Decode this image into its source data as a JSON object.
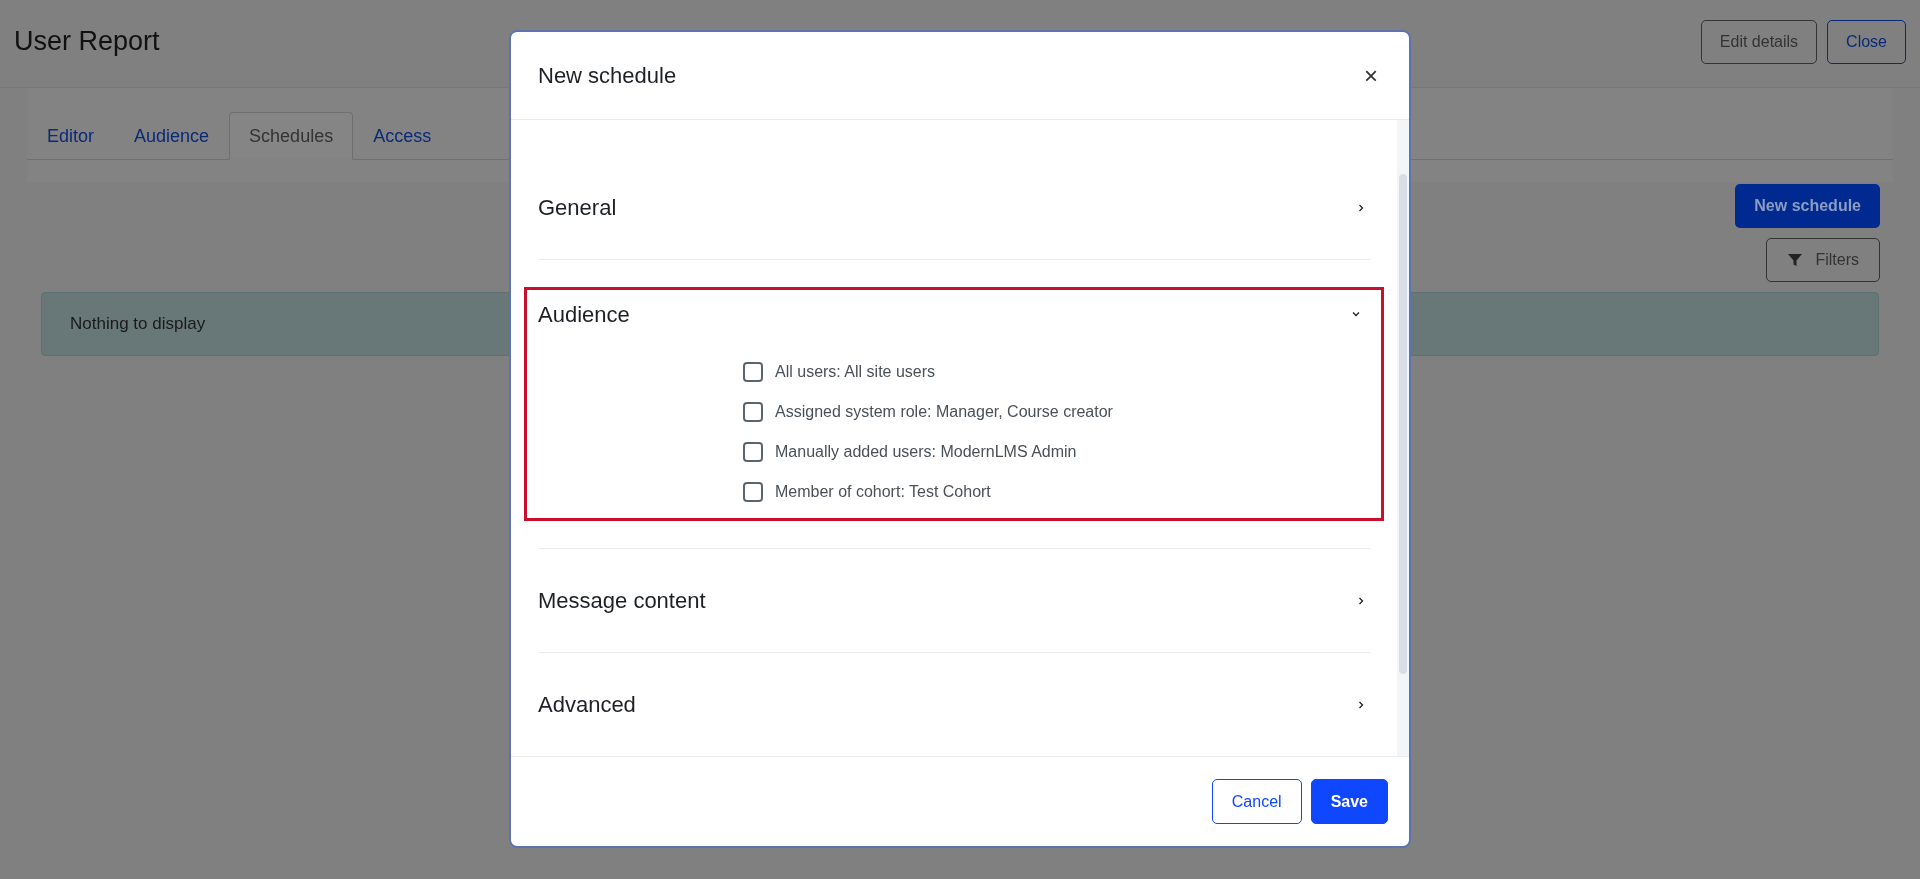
{
  "page": {
    "title": "User Report",
    "header_buttons": [
      {
        "label": "Edit details",
        "kind": "secondary"
      },
      {
        "label": "Close",
        "kind": "outline"
      }
    ]
  },
  "tabs": [
    {
      "label": "Editor",
      "selected": false
    },
    {
      "label": "Audience",
      "selected": false
    },
    {
      "label": "Schedules",
      "selected": true
    },
    {
      "label": "Access",
      "selected": false
    }
  ],
  "toolbar": {
    "new_button": "New schedule",
    "filters_button": "Filters"
  },
  "alert": "Nothing to display",
  "modal": {
    "title": "New schedule",
    "close": "×",
    "sections": [
      {
        "title": "General",
        "expanded": false,
        "highlighted": false
      },
      {
        "title": "Audience",
        "expanded": true,
        "highlighted": true,
        "options": [
          {
            "label": "All users: All site users",
            "checked": false
          },
          {
            "label": "Assigned system role: Manager, Course creator",
            "checked": false
          },
          {
            "label": "Manually added users: ModernLMS Admin",
            "checked": false
          },
          {
            "label": "Member of cohort: Test Cohort",
            "checked": false
          }
        ]
      },
      {
        "title": "Message content",
        "expanded": false,
        "highlighted": false
      },
      {
        "title": "Advanced",
        "expanded": false,
        "highlighted": false
      }
    ],
    "buttons": [
      {
        "label": "Cancel",
        "kind": "outline"
      },
      {
        "label": "Save",
        "kind": "primary"
      }
    ]
  }
}
